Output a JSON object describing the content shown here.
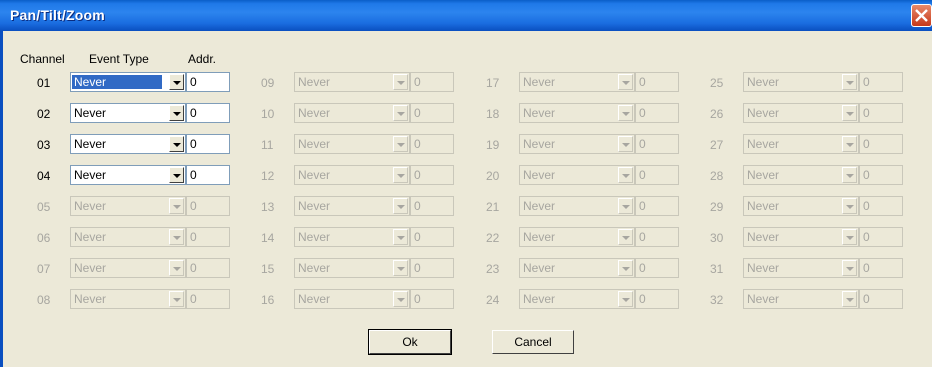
{
  "window": {
    "title": "Pan/Tilt/Zoom"
  },
  "headers": {
    "channel": "Channel",
    "event_type": "Event Type",
    "addr": "Addr."
  },
  "channels": [
    {
      "num": "01",
      "event": "Never",
      "addr": "0",
      "enabled": true,
      "selected": true
    },
    {
      "num": "02",
      "event": "Never",
      "addr": "0",
      "enabled": true
    },
    {
      "num": "03",
      "event": "Never",
      "addr": "0",
      "enabled": true
    },
    {
      "num": "04",
      "event": "Never",
      "addr": "0",
      "enabled": true
    },
    {
      "num": "05",
      "event": "Never",
      "addr": "0",
      "enabled": false
    },
    {
      "num": "06",
      "event": "Never",
      "addr": "0",
      "enabled": false
    },
    {
      "num": "07",
      "event": "Never",
      "addr": "0",
      "enabled": false
    },
    {
      "num": "08",
      "event": "Never",
      "addr": "0",
      "enabled": false
    },
    {
      "num": "09",
      "event": "Never",
      "addr": "0",
      "enabled": false
    },
    {
      "num": "10",
      "event": "Never",
      "addr": "0",
      "enabled": false
    },
    {
      "num": "11",
      "event": "Never",
      "addr": "0",
      "enabled": false
    },
    {
      "num": "12",
      "event": "Never",
      "addr": "0",
      "enabled": false
    },
    {
      "num": "13",
      "event": "Never",
      "addr": "0",
      "enabled": false
    },
    {
      "num": "14",
      "event": "Never",
      "addr": "0",
      "enabled": false
    },
    {
      "num": "15",
      "event": "Never",
      "addr": "0",
      "enabled": false
    },
    {
      "num": "16",
      "event": "Never",
      "addr": "0",
      "enabled": false
    },
    {
      "num": "17",
      "event": "Never",
      "addr": "0",
      "enabled": false
    },
    {
      "num": "18",
      "event": "Never",
      "addr": "0",
      "enabled": false
    },
    {
      "num": "19",
      "event": "Never",
      "addr": "0",
      "enabled": false
    },
    {
      "num": "20",
      "event": "Never",
      "addr": "0",
      "enabled": false
    },
    {
      "num": "21",
      "event": "Never",
      "addr": "0",
      "enabled": false
    },
    {
      "num": "22",
      "event": "Never",
      "addr": "0",
      "enabled": false
    },
    {
      "num": "23",
      "event": "Never",
      "addr": "0",
      "enabled": false
    },
    {
      "num": "24",
      "event": "Never",
      "addr": "0",
      "enabled": false
    },
    {
      "num": "25",
      "event": "Never",
      "addr": "0",
      "enabled": false
    },
    {
      "num": "26",
      "event": "Never",
      "addr": "0",
      "enabled": false
    },
    {
      "num": "27",
      "event": "Never",
      "addr": "0",
      "enabled": false
    },
    {
      "num": "28",
      "event": "Never",
      "addr": "0",
      "enabled": false
    },
    {
      "num": "29",
      "event": "Never",
      "addr": "0",
      "enabled": false
    },
    {
      "num": "30",
      "event": "Never",
      "addr": "0",
      "enabled": false
    },
    {
      "num": "31",
      "event": "Never",
      "addr": "0",
      "enabled": false
    },
    {
      "num": "32",
      "event": "Never",
      "addr": "0",
      "enabled": false
    }
  ],
  "buttons": {
    "ok": "Ok",
    "cancel": "Cancel"
  },
  "icons": {
    "close": "close-icon",
    "dropdown": "chevron-down-icon"
  }
}
